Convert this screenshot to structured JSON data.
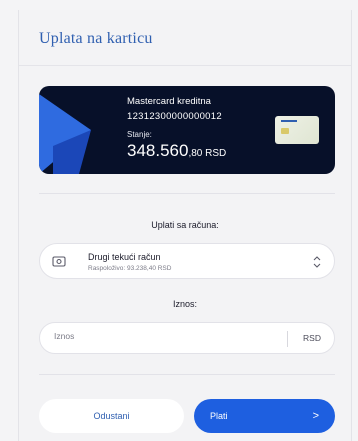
{
  "modal": {
    "title": "Uplata na karticu"
  },
  "card": {
    "name": "Mastercard kreditna",
    "number": "12312300000000012",
    "balance_label": "Stanje:",
    "balance_main": "348.560",
    "balance_decimal": ",80 RSD"
  },
  "from_account": {
    "label": "Uplati sa računa:",
    "account_name": "Drugi tekući račun",
    "available": "Raspoloživo: 93.238,40 RSD"
  },
  "amount": {
    "label": "Iznos:",
    "placeholder": "Iznos",
    "currency": "RSD"
  },
  "actions": {
    "cancel_label": "Odustani",
    "pay_label": "Plati",
    "pay_arrow": ">"
  },
  "colors": {
    "accent": "#1e5fe0",
    "title": "#2f5fb0",
    "card_bg": "#071029"
  }
}
